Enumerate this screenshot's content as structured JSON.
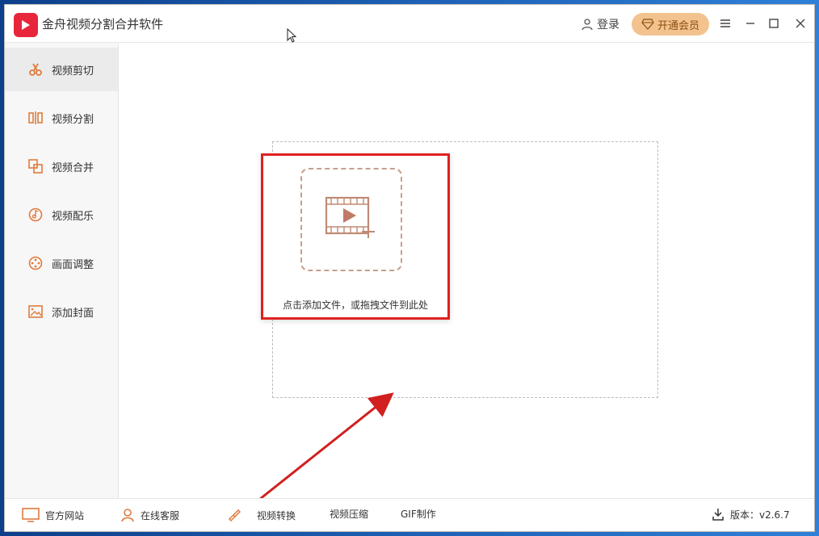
{
  "app": {
    "title": "金舟视频分割合并软件",
    "login_label": "登录",
    "vip_label": "开通会员"
  },
  "sidebar": {
    "items": [
      {
        "label": "视频剪切",
        "icon": "scissors-icon"
      },
      {
        "label": "视频分割",
        "icon": "split-icon"
      },
      {
        "label": "视频合并",
        "icon": "merge-icon"
      },
      {
        "label": "视频配乐",
        "icon": "music-icon"
      },
      {
        "label": "画面调整",
        "icon": "adjust-icon"
      },
      {
        "label": "添加封面",
        "icon": "cover-icon"
      }
    ]
  },
  "main": {
    "drop_text": "点击添加文件，或拖拽文件到此处"
  },
  "bottom": {
    "items": [
      {
        "label": "官方网站",
        "icon": "monitor-icon"
      },
      {
        "label": "在线客服",
        "icon": "support-icon"
      },
      {
        "label": "视频转换",
        "icon": "flashlight-icon"
      },
      {
        "label": "视频压缩",
        "icon": ""
      },
      {
        "label": "GIF制作",
        "icon": ""
      }
    ],
    "version": "版本：v2.6.7"
  },
  "colors": {
    "accent": "#e8263b",
    "vip": "#f2c38e",
    "highlight": "#e02020",
    "icon": "#e07b3c"
  }
}
